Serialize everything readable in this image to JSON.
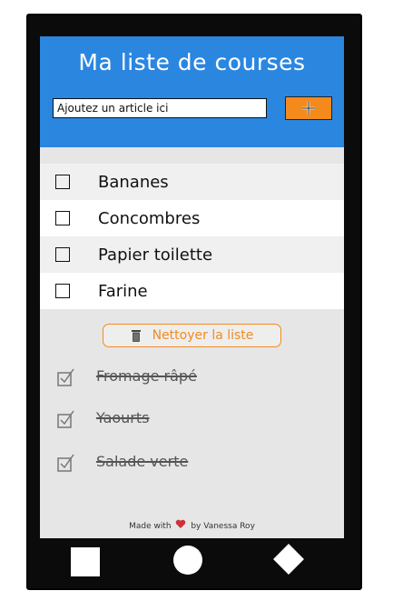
{
  "app": {
    "title": "Ma liste de courses"
  },
  "add_form": {
    "placeholder": "Ajoutez un article ici",
    "add_icon": "plus-icon"
  },
  "todo_items": [
    {
      "label": "Bananes",
      "checked": false
    },
    {
      "label": "Concombres",
      "checked": false
    },
    {
      "label": "Papier toilette",
      "checked": false
    },
    {
      "label": "Farine",
      "checked": false
    }
  ],
  "clear_button": {
    "label": "Nettoyer la liste",
    "icon": "trash-icon"
  },
  "done_items": [
    {
      "label": "Fromage râpé",
      "checked": true
    },
    {
      "label": "Yaourts",
      "checked": true
    },
    {
      "label": "Salade verte",
      "checked": true
    }
  ],
  "footer": {
    "prefix": "Made with",
    "suffix": "by Vanessa Roy",
    "icon": "heart-icon"
  },
  "nav": {
    "back": "square-icon",
    "home": "circle-icon",
    "recent": "diamond-icon"
  },
  "colors": {
    "header": "#2b86df",
    "accent": "#f48a1c",
    "phone": "#0b0b0b",
    "screen_bg": "#e6e6e6",
    "heart": "#d0303a"
  }
}
